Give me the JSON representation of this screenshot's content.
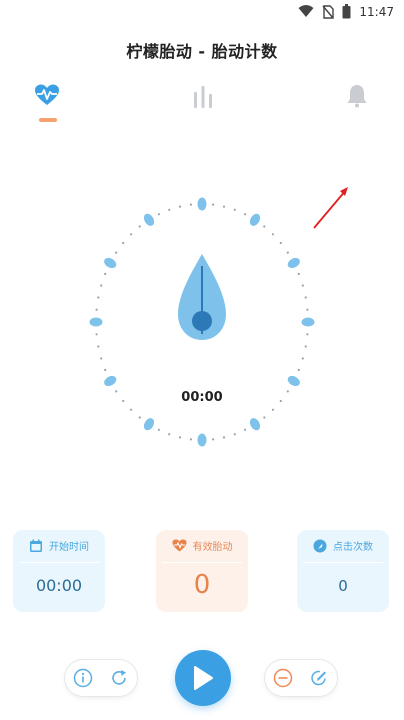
{
  "status_bar": {
    "time": "11:47",
    "icons": [
      "wifi-icon",
      "no-sim-icon",
      "battery-icon"
    ]
  },
  "header": {
    "title": "柠檬胎动 - 胎动计数"
  },
  "tabs": [
    {
      "icon": "heart-pulse-icon",
      "active": true
    },
    {
      "icon": "bar-chart-icon",
      "active": false
    },
    {
      "icon": "bell-icon",
      "active": false
    }
  ],
  "dial": {
    "time": "00:00"
  },
  "cards": {
    "start_time": {
      "label": "开始时间",
      "value": "00:00",
      "icon": "calendar-icon"
    },
    "valid_movements": {
      "label": "有效胎动",
      "value": "0",
      "icon": "heart-icon"
    },
    "click_count": {
      "label": "点击次数",
      "value": "0",
      "icon": "click-icon"
    }
  },
  "controls": {
    "left": [
      "info-icon",
      "refresh-icon"
    ],
    "center": "play-icon",
    "right": [
      "minus-icon",
      "edit-icon"
    ]
  },
  "colors": {
    "blue": "#3aa0e3",
    "light_blue": "#eaf6fd",
    "orange": "#e8834a",
    "light_orange": "#fdf1e9"
  }
}
